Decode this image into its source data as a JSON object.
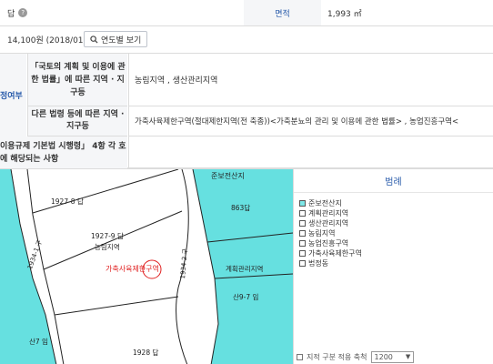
{
  "top_row": {
    "left_label": "답",
    "area_label": "면적",
    "area_value": "1,993 ㎡"
  },
  "price_row": {
    "price": "14,100원 (2018/01)",
    "yearly_button": "연도별 보기"
  },
  "zone_rows": {
    "side_header": "정여부",
    "row1_label": "「국토의 계획 및 이용에 관한 법률」에 따른 지역 · 지구등",
    "row1_value": "농림지역 , 생산관리지역",
    "row2_label": "다른 법령 등에 따른 지역 · 지구등",
    "row2_value": "가축사육제한구역(절대제한지역(전 축종))<가축분뇨의 관리 및 이용에 관한 법률> , 농업진흥구역<",
    "row3_label": "이용규제 기본법 시행령」 4항 각 호에 해당되는 사항",
    "row3_value": ""
  },
  "map": {
    "labels": {
      "top_zone": "준보전산지",
      "p1927_8": "1927-8 답",
      "p863": "863답",
      "p1927_9": "1927-9 답",
      "p1927_9_sub": "농림지역",
      "restrict": "가축사육제한구역",
      "road1": "1934-1 구",
      "road2": "1934-2 구",
      "mgmt": "계획관리지역",
      "mt9_7": "산9-7 임",
      "mt7": "산7 임",
      "p1928": "1928 답"
    }
  },
  "legend": {
    "title": "범례",
    "items": [
      {
        "label": "준보전산지",
        "color": "#7ee8e8"
      },
      {
        "label": "계획관리지역",
        "color": "#ffffff"
      },
      {
        "label": "생산관리지역",
        "color": "#ffffff"
      },
      {
        "label": "농림지역",
        "color": "#ffffff"
      },
      {
        "label": "농업진흥구역",
        "color": "#ffffff"
      },
      {
        "label": "가축사육제한구역",
        "color": "#ffffff"
      },
      {
        "label": "법정동",
        "color": "#ffffff"
      }
    ]
  },
  "bottom": {
    "text": "지적 구분 적용  축척",
    "scale": "1200"
  }
}
